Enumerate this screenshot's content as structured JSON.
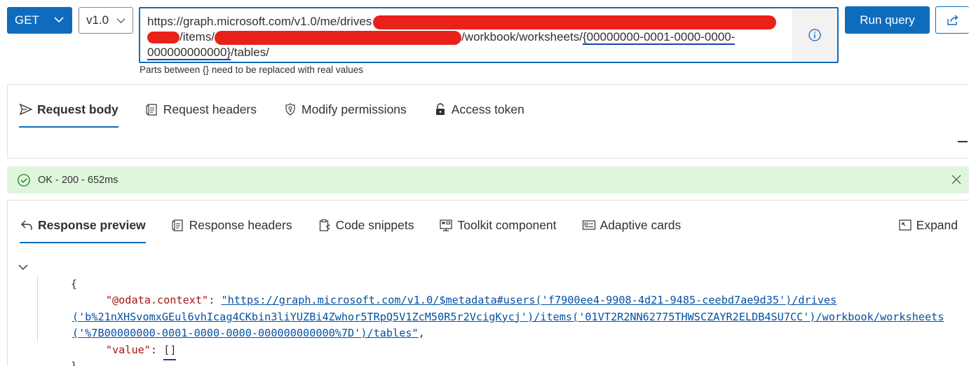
{
  "query": {
    "method": "GET",
    "version": "v1.0",
    "url_line1_prefix": "https://graph.microsoft.com/v1.0/me/drives",
    "url_line2_items": "/items/",
    "url_line2_suffix": "/workbook/worksheets/",
    "url_line2_placeholder": "{00000000-0001-0000-0000-",
    "url_line3_placeholder": "000000000000}",
    "url_line3_suffix": "/tables/",
    "helper_text": "Parts between {} need to be replaced with real values",
    "run_label": "Run query",
    "share_icon": "share-icon",
    "info_icon": "info-icon"
  },
  "request_tabs": [
    {
      "label": "Request body",
      "icon": "send-icon",
      "active": true
    },
    {
      "label": "Request headers",
      "icon": "headers-icon",
      "active": false
    },
    {
      "label": "Modify permissions",
      "icon": "shield-key-icon",
      "active": false
    },
    {
      "label": "Access token",
      "icon": "lock-icon",
      "active": false
    }
  ],
  "status": {
    "text": "OK - 200 - 652ms",
    "color": "#dff6dd"
  },
  "response_tabs": [
    {
      "label": "Response preview",
      "icon": "undo-icon",
      "active": true
    },
    {
      "label": "Response headers",
      "icon": "headers-icon",
      "active": false
    },
    {
      "label": "Code snippets",
      "icon": "clipboard-icon",
      "active": false
    },
    {
      "label": "Toolkit component",
      "icon": "toolkit-icon",
      "active": false
    },
    {
      "label": "Adaptive cards",
      "icon": "card-icon",
      "active": false
    }
  ],
  "expand_label": "Expand",
  "response": {
    "open_brace": "{",
    "context_key": "\"@odata.context\"",
    "context_line1": "\"https://graph.microsoft.com/v1.0/$metadata#users('f7900ee4-9908-4d21-9485-ceebd7ae9d35')/drives",
    "context_line2": "('b%21nXHSvomxGEul6vhIcag4CKbin3liYUZBi4Zwhor5TRpQ5V1ZcM50R5r2VcigKycj')/items('01VT2R2NN62775THWSCZAYR2ELDB4SU7CC')/workbook/worksheets",
    "context_line3": "('%7B00000000-0001-0000-0000-000000000000%7D')/tables\"",
    "value_key": "\"value\"",
    "value_val": "[]",
    "close_brace": "}"
  },
  "colors": {
    "accent": "#0f6cbd",
    "success_bg": "#dff6dd",
    "json_key": "#a31515",
    "json_link": "#0451a5",
    "redaction": "#e8221b"
  }
}
